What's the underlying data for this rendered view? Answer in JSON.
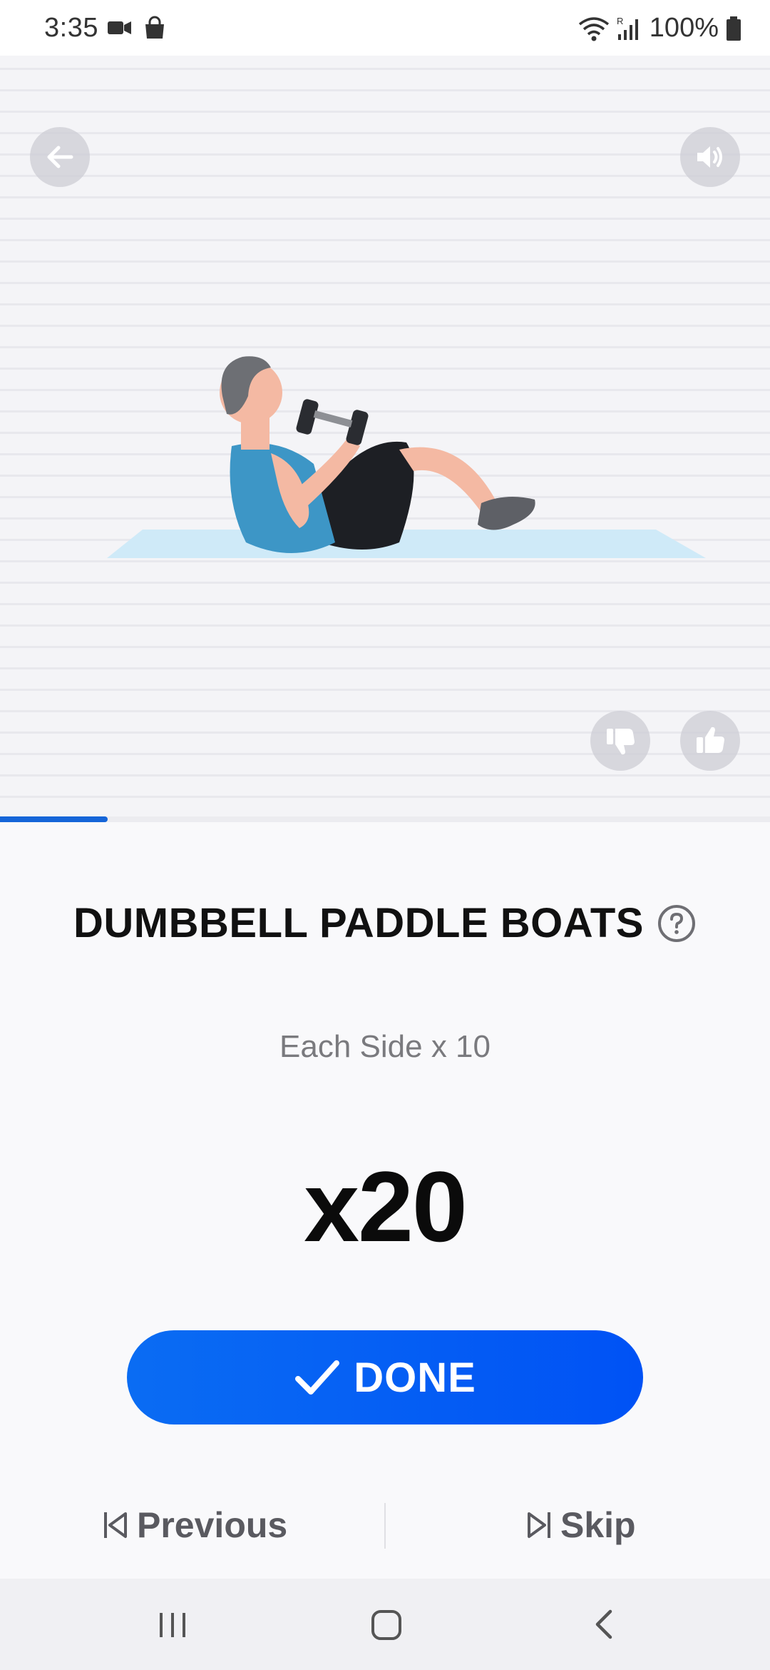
{
  "status_bar": {
    "time": "3:35",
    "battery": "100%",
    "icons": [
      "video-camera-icon",
      "shopping-bag-icon",
      "wifi-icon",
      "signal-icon",
      "battery-icon"
    ]
  },
  "media": {
    "back_icon": "arrow-left-icon",
    "sound_icon": "speaker-icon",
    "dislike_icon": "thumbs-down-icon",
    "like_icon": "thumbs-up-icon"
  },
  "progress": {
    "fraction": 0.14,
    "color": "#1565d8"
  },
  "exercise": {
    "title": "DUMBBELL PADDLE BOATS",
    "help_icon": "question-circle-icon",
    "subtitle": "Each Side x 10",
    "reps": "x20"
  },
  "done_button": {
    "label": "DONE",
    "icon": "checkmark-icon",
    "color": "#0a6cf3"
  },
  "navigation": {
    "previous_label": "Previous",
    "skip_label": "Skip"
  },
  "system_nav": {
    "icons": [
      "recent-apps-icon",
      "home-icon",
      "back-icon"
    ]
  }
}
